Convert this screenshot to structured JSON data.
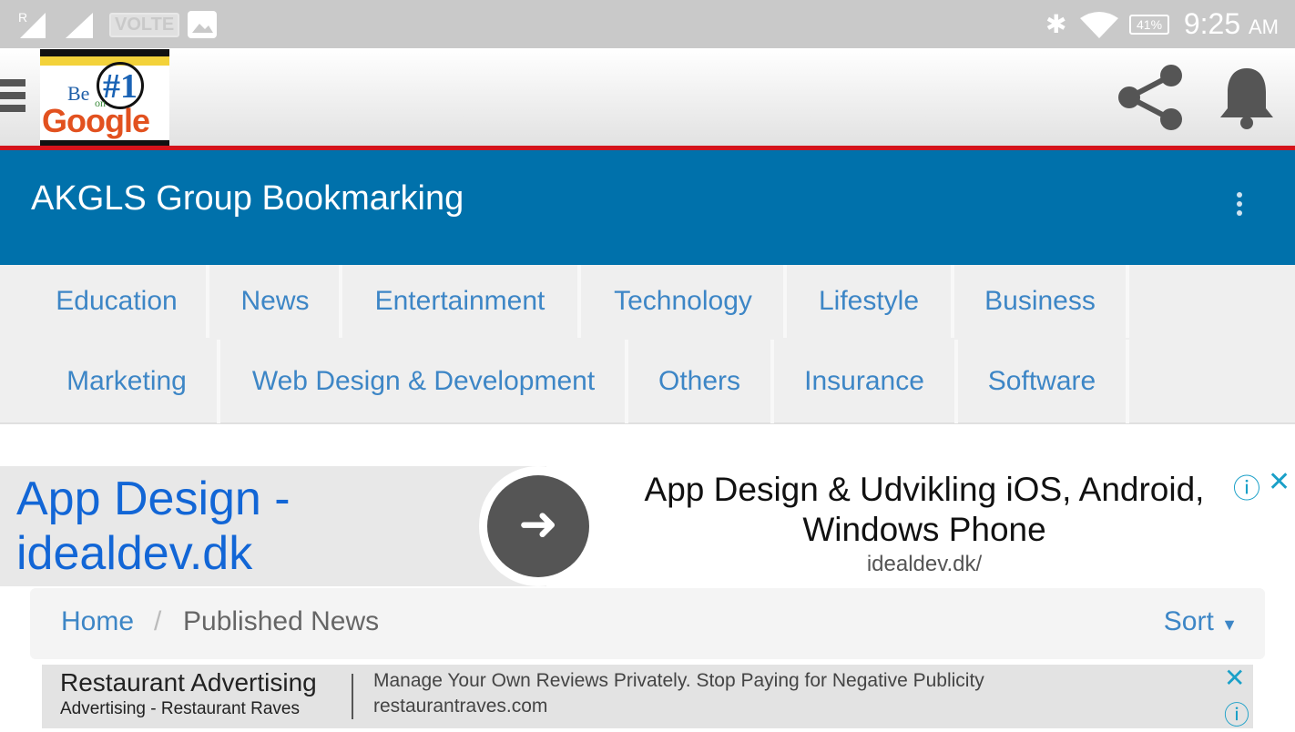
{
  "status": {
    "signal1": "R",
    "volte": "VOLTE",
    "battery": "41%",
    "time": "9:25",
    "ampm": "AM"
  },
  "header": {
    "logo_text": "Be #1 on Google"
  },
  "titlebar": {
    "title": "AKGLS Group Bookmarking"
  },
  "categories": [
    "Education",
    "News",
    "Entertainment",
    "Technology",
    "Lifestyle",
    "Business",
    "Marketing",
    "Web Design & Development",
    "Others",
    "Insurance",
    "Software"
  ],
  "ad_top": {
    "left_title": "App Design - idealdev.dk",
    "headline": "App Design & Udvikling iOS, Android, Windows Phone",
    "url": "idealdev.dk/"
  },
  "breadcrumb": {
    "home": "Home",
    "sep": "/",
    "current": "Published News",
    "sort": "Sort"
  },
  "ad_bottom": {
    "title": "Restaurant Advertising",
    "subtitle": "Advertising - Restaurant Raves",
    "desc": "Manage Your Own Reviews Privately. Stop Paying for Negative Publicity",
    "url": "restaurantraves.com"
  }
}
